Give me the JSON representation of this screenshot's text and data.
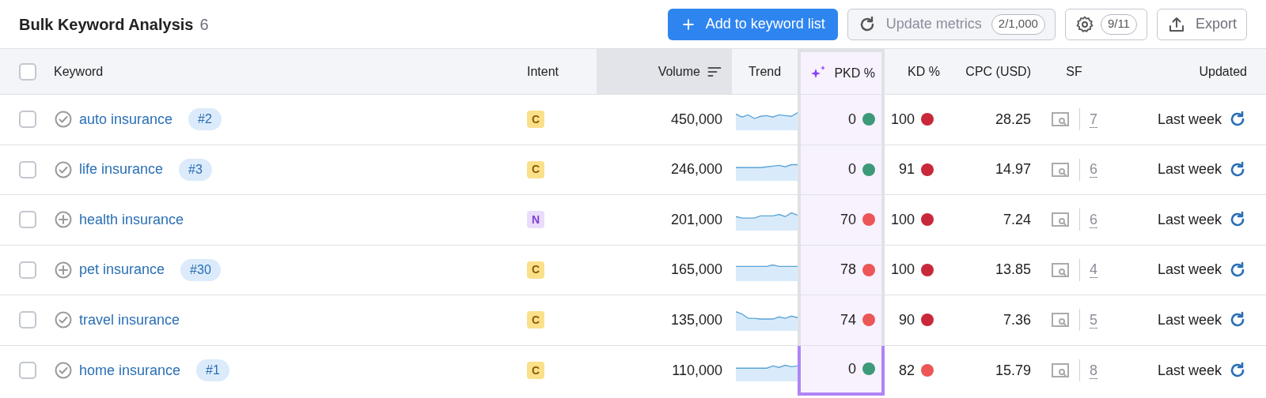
{
  "title": "Bulk Keyword Analysis",
  "count": "6",
  "toolbar": {
    "add_button": "Add to keyword list",
    "update_button": "Update metrics",
    "update_count": "2/1,000",
    "settings_count": "9/11",
    "export_button": "Export"
  },
  "select_all": {
    "checked": false
  },
  "columns": [
    {
      "label": "Keyword",
      "sorted": false,
      "highlighted": false
    },
    {
      "label": "Intent",
      "sorted": false,
      "highlighted": false
    },
    {
      "label": "Volume",
      "sorted": true,
      "highlighted": false
    },
    {
      "label": "Trend",
      "sorted": false,
      "highlighted": false
    },
    {
      "label": "PKD %",
      "sorted": false,
      "highlighted": true
    },
    {
      "label": "KD %",
      "sorted": false,
      "highlighted": false
    },
    {
      "label": "CPC (USD)",
      "sorted": false,
      "highlighted": false
    },
    {
      "label": "SF",
      "sorted": false,
      "highlighted": false
    },
    {
      "label": "Updated",
      "sorted": false,
      "highlighted": false
    }
  ],
  "rows": [
    {
      "checked": false,
      "kind": "added",
      "keyword": "auto insurance",
      "rank": "#2",
      "intent": "C",
      "volume": "450,000",
      "pkd": {
        "value": "0",
        "color": "#3c9a78"
      },
      "kd": {
        "value": "100",
        "color": "#c8283a"
      },
      "cpc": "28.25",
      "sf": "7",
      "updated": "Last week"
    },
    {
      "checked": false,
      "kind": "added",
      "keyword": "life insurance",
      "rank": "#3",
      "intent": "C",
      "volume": "246,000",
      "pkd": {
        "value": "0",
        "color": "#3c9a78"
      },
      "kd": {
        "value": "91",
        "color": "#c8283a"
      },
      "cpc": "14.97",
      "sf": "6",
      "updated": "Last week"
    },
    {
      "checked": false,
      "kind": "new",
      "keyword": "health insurance",
      "intent": "N",
      "volume": "201,000",
      "pkd": {
        "value": "70",
        "color": "#ec5656"
      },
      "kd": {
        "value": "100",
        "color": "#c8283a"
      },
      "cpc": "7.24",
      "sf": "6",
      "updated": "Last week"
    },
    {
      "checked": false,
      "kind": "new",
      "keyword": "pet insurance",
      "rank": "#30",
      "intent": "C",
      "volume": "165,000",
      "pkd": {
        "value": "78",
        "color": "#ec5656"
      },
      "kd": {
        "value": "100",
        "color": "#c8283a"
      },
      "cpc": "13.85",
      "sf": "4",
      "updated": "Last week"
    },
    {
      "checked": false,
      "kind": "added",
      "keyword": "travel insurance",
      "intent": "C",
      "volume": "135,000",
      "pkd": {
        "value": "74",
        "color": "#ec5656"
      },
      "kd": {
        "value": "90",
        "color": "#c8283a"
      },
      "cpc": "7.36",
      "sf": "5",
      "updated": "Last week"
    },
    {
      "checked": false,
      "kind": "added",
      "keyword": "home insurance",
      "rank": "#1",
      "intent": "C",
      "volume": "110,000",
      "pkd": {
        "value": "0",
        "color": "#3c9a78"
      },
      "kd": {
        "value": "82",
        "color": "#ec5656"
      },
      "cpc": "15.79",
      "sf": "8",
      "updated": "Last week"
    }
  ]
}
